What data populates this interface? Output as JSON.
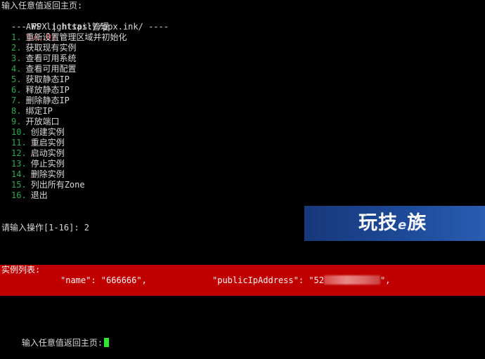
{
  "terminal": {
    "prompt_return_top": "输入任意值返回主页:",
    "app_title": "AWS lightsail管理",
    "app_version": "[v1.0]",
    "subtitle": "--- PPX | https://ppx.ink/ ----",
    "menu": [
      {
        "num": "1.",
        "label": "重新设置管理区域并初始化"
      },
      {
        "num": "2.",
        "label": "获取现有实例"
      },
      {
        "num": "3.",
        "label": "查看可用系统"
      },
      {
        "num": "4.",
        "label": "查看可用配置"
      },
      {
        "num": "5.",
        "label": "获取静态IP"
      },
      {
        "num": "6.",
        "label": "释放静态IP"
      },
      {
        "num": "7.",
        "label": "删除静态IP"
      },
      {
        "num": "8.",
        "label": "绑定IP"
      },
      {
        "num": "9.",
        "label": "开放端口"
      },
      {
        "num": "10.",
        "label": "创建实例"
      },
      {
        "num": "11.",
        "label": "重启实例"
      },
      {
        "num": "12.",
        "label": "启动实例"
      },
      {
        "num": "13.",
        "label": "停止实例"
      },
      {
        "num": "14.",
        "label": "删除实例"
      },
      {
        "num": "15.",
        "label": "列出所有Zone"
      },
      {
        "num": "16.",
        "label": "退出"
      }
    ],
    "operation_prompt": "请输入操作[1-16]: 2",
    "instance_list_header": "实例列表:",
    "json_name": "\"name\": \"666666\",",
    "json_ip_prefix": "\"publicIpAddress\": \"52",
    "json_ip_suffix": "\",",
    "prompt_return_bottom": "输入任意值返回主页:"
  },
  "watermark": {
    "text_main": "玩技",
    "text_e": "e",
    "text_end": "族"
  },
  "colors": {
    "background": "#000000",
    "text": "#d8d8d8",
    "menu_number": "#2fa84f",
    "version": "#d03030",
    "highlight_block": "#c00000",
    "cursor": "#2ee82e",
    "banner": "#1d4a98"
  }
}
